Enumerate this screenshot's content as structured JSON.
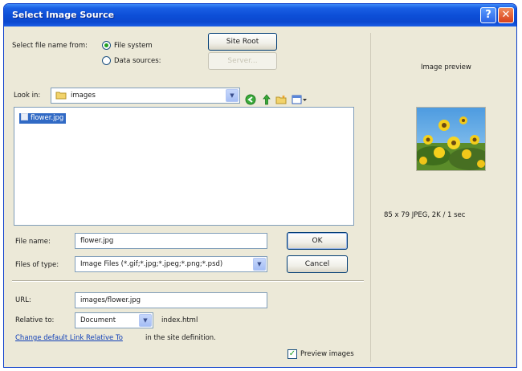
{
  "window": {
    "title": "Select Image Source",
    "help_glyph": "?",
    "close_glyph": "✕"
  },
  "source": {
    "label": "Select file name from:",
    "option_file_system": "File system",
    "option_data_sources": "Data sources:",
    "site_root_button": "Site Root",
    "server_button": "Server..."
  },
  "look_in": {
    "label": "Look in:",
    "value": "images"
  },
  "toolbar_icons": [
    "back-arrow-icon",
    "up-folder-icon",
    "new-folder-icon",
    "view-menu-icon"
  ],
  "files": [
    {
      "name": "flower.jpg",
      "selected": true
    }
  ],
  "file_name": {
    "label": "File name:",
    "value": "flower.jpg"
  },
  "files_of_type": {
    "label": "Files of type:",
    "value": "Image Files (*.gif;*.jpg;*.jpeg;*.png;*.psd)"
  },
  "buttons": {
    "ok": "OK",
    "cancel": "Cancel"
  },
  "url": {
    "label": "URL:",
    "value": "images/flower.jpg"
  },
  "relative_to": {
    "label": "Relative to:",
    "value": "Document",
    "doc_name": "index.html"
  },
  "footer": {
    "link_text": "Change default Link Relative To",
    "trailing_text": "in the site definition."
  },
  "preview": {
    "title": "Image preview",
    "info": "85 x 79 JPEG, 2K / 1 sec",
    "checkbox_label": "Preview images",
    "checked": true
  },
  "colors": {
    "title_bar": "#0b48cf",
    "dialog_bg": "#ece9d8",
    "selection": "#316ac5",
    "link": "#1140b8"
  }
}
